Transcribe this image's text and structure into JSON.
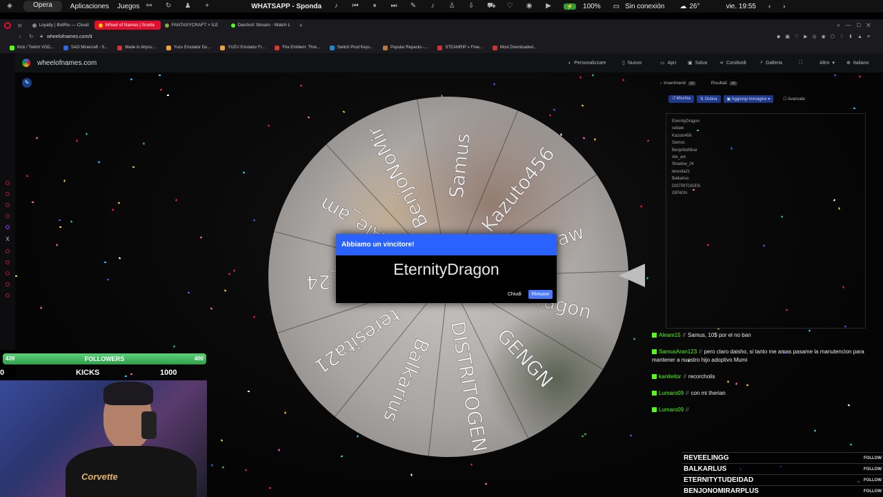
{
  "os_bar": {
    "opera_label": "Opera",
    "apps_label": "Aplicaciones",
    "games_label": "Juegos",
    "center_title": "WHATSAPP - Sponda",
    "battery": "100%",
    "network": "Sin conexión",
    "weather": "26°",
    "clock": "vie. 19:55"
  },
  "browser": {
    "tabs": [
      {
        "label": "Loyalty | BotRix — Cloud",
        "color": "#4a9"
      },
      {
        "label": "Wheel of Names | Scelta",
        "color": "#fff"
      },
      {
        "label": "FANTASYCRAFT × ILE",
        "color": "#8a4"
      },
      {
        "label": "DaishoX Stream - Watch L",
        "color": "#53fc18"
      }
    ],
    "url": "wheelofnames.com/it",
    "bookmarks": [
      {
        "label": "Kick / Twitch VOD...",
        "color": "#53fc18"
      },
      {
        "label": "SAO Minecraft - S...",
        "color": "#2a6bd6"
      },
      {
        "label": "Made in Abyss:...",
        "color": "#c33"
      },
      {
        "label": "Yuzu Emulator Do...",
        "color": "#e8a33c"
      },
      {
        "label": "YUZU Emulator Fr...",
        "color": "#e8a33c"
      },
      {
        "label": "Fire Emblem: Thre...",
        "color": "#d33"
      },
      {
        "label": "Switch Prod Keys...",
        "color": "#1a8ad4"
      },
      {
        "label": "Popular Repacks -...",
        "color": "#b07a3a"
      },
      {
        "label": "STEAMRIP » Free...",
        "color": "#c33"
      },
      {
        "label": "Most Downloaded...",
        "color": "#c33"
      }
    ]
  },
  "site": {
    "name": "wheelofnames.com",
    "menu": {
      "personalize": "Personalizzare",
      "new": "Nuovo",
      "open": "Apri",
      "save": "Salva",
      "share": "Condividi",
      "gallery": "Galleria",
      "more": "Altro",
      "language": "Italiano"
    }
  },
  "wheel": {
    "segments": [
      "Samus",
      "Kazuto456",
      "sebaw",
      "EternityDragon",
      "GENGN",
      "DISTRITOGEN",
      "Balkarius",
      "teresita21",
      "Shadow_24",
      "Ale_am",
      "BenjoNoMirar"
    ],
    "visible_labels": [
      "Samus",
      "Kazuto456",
      "sebaw",
      "Dragon",
      "GENGN",
      "DISTRITOGEN",
      "Balkarius",
      "teresita21",
      "ow_24",
      "Ale_am",
      "BenjoNoMir"
    ]
  },
  "dialog": {
    "title": "Abbiamo un vincitore!",
    "winner": "EternityDragon",
    "close_label": "Chiudi",
    "remove_label": "Rimuovi"
  },
  "panel": {
    "tab_entries": "Inserimenti",
    "tab_entries_count": "11",
    "tab_results": "Risultati",
    "tab_results_count": "15",
    "shuffle": "Mischia",
    "sort": "Ordina",
    "add_image": "Aggiungi immagine",
    "advanced": "Avanzate",
    "entries": [
      "EternityDragon",
      "sebaw",
      "Kazuto456",
      "Samus",
      "BenjoNoMirar",
      "Ale_am",
      "Shadow_24",
      "teresita21",
      "Balkarius",
      "DISTRITOGEN",
      "GENGN"
    ]
  },
  "chat": [
    {
      "user": "Aleam15",
      "text": "Samus, 10$ por el no ban"
    },
    {
      "user": "SamusAran123",
      "text": "pero claro daisho, si tanto me amas pasame la manutencion para mantener a nuestro hijo adoptivo Mumi"
    },
    {
      "user": "kaniteitor",
      "text": "recorcholis"
    },
    {
      "user": "Lumaro09",
      "text": "con mi therian"
    },
    {
      "user": "Lumaro09",
      "text": ""
    }
  ],
  "followers": {
    "label": "FOLLOWERS",
    "current": "439",
    "goal": "400",
    "progress": 1.0
  },
  "kicks": {
    "left": "0",
    "label": "KICKS",
    "value": "1000"
  },
  "follow_list": {
    "follow_label": "FOLLOW",
    "names": [
      "REVEELINGG",
      "BALKARLUS",
      "ETERNITYTUDEIDAD",
      "BENJONOMIRARPLUS"
    ]
  }
}
